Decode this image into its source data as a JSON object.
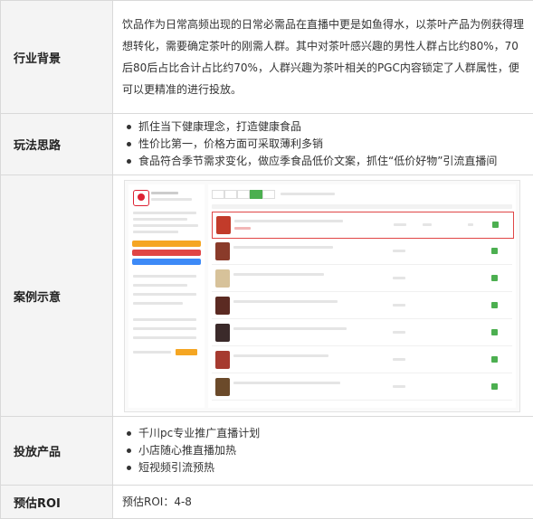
{
  "rows": {
    "background": {
      "label": "行业背景",
      "text": "饮品作为日常高频出现的日常必需品在直播中更是如鱼得水，以茶叶产品为例获得理想转化，需要确定茶叶的刚需人群。其中对茶叶感兴趣的男性人群占比约80%，70后80后占比合计占比约70%，人群兴趣为茶叶相关的PGC内容锁定了人群属性，便可以更精准的进行投放。"
    },
    "approach": {
      "label": "玩法思路",
      "items": [
        "抓住当下健康理念，打造健康食品",
        "性价比第一，价格方面可采取薄利多销",
        "食品符合季节需求变化，做应季食品低价文案，抓住“低价好物”引流直播间"
      ]
    },
    "case": {
      "label": "案例示意"
    },
    "products": {
      "label": "投放产品",
      "items": [
        "千川pc专业推广直播计划",
        "小店随心推直播加热",
        "短视频引流预热"
      ]
    },
    "roi": {
      "label": "预估ROI",
      "text": "预估ROI：4-8"
    }
  },
  "colors": {
    "label_bg": "#f4f4f4",
    "border": "#d9d9d9",
    "highlight": "#e04545",
    "green": "#4caf50"
  }
}
